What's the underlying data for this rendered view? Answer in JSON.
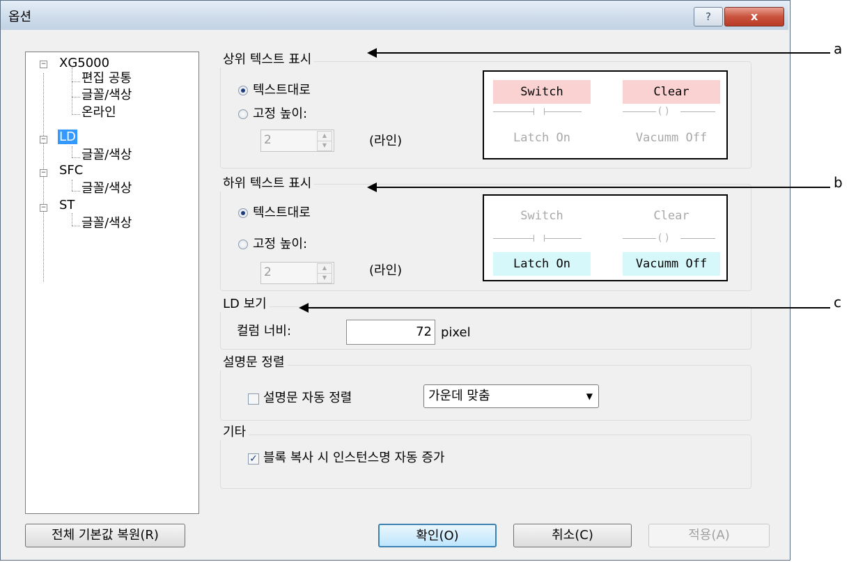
{
  "window": {
    "title": "옵션",
    "help_glyph": "?",
    "close_glyph": "x"
  },
  "tree": {
    "items": [
      {
        "label": "XG5000",
        "expander": "−"
      },
      {
        "label": "편집 공통"
      },
      {
        "label": "글꼴/색상"
      },
      {
        "label": "온라인"
      },
      {
        "label": "LD",
        "expander": "−",
        "selected": true
      },
      {
        "label": "글꼴/색상"
      },
      {
        "label": "SFC",
        "expander": "−"
      },
      {
        "label": "글꼴/색상"
      },
      {
        "label": "ST",
        "expander": "−"
      },
      {
        "label": "글꼴/색상"
      }
    ]
  },
  "upper_text": {
    "group_label": "상위 텍스트 표시",
    "radio_as_text": "텍스트대로",
    "radio_fixed": "고정 높이:",
    "spin_value": "2",
    "unit": "(라인)",
    "preview": {
      "left_top": "Switch",
      "right_top": "Clear",
      "left_bottom": "Latch On",
      "right_bottom": "Vacumm Off",
      "coil": "( )"
    }
  },
  "lower_text": {
    "group_label": "하위 텍스트 표시",
    "radio_as_text": "텍스트대로",
    "radio_fixed": "고정 높이:",
    "spin_value": "2",
    "unit": "(라인)",
    "preview": {
      "left_top": "Switch",
      "right_top": "Clear",
      "left_bottom": "Latch On",
      "right_bottom": "Vacumm Off",
      "coil": "( )"
    }
  },
  "ld_view": {
    "group_label": "LD 보기",
    "column_width_label": "컬럼 너비:",
    "column_width_value": "72",
    "unit": "pixel"
  },
  "comment_align": {
    "group_label": "설명문 정렬",
    "auto_align_label": "설명문 자동 정렬",
    "auto_align_checked": false,
    "align_option": "가운데 맞춤"
  },
  "misc": {
    "group_label": "기타",
    "block_copy_label": "블록 복사 시 인스턴스명 자동 증가",
    "block_copy_checked": true
  },
  "buttons": {
    "restore_defaults": "전체 기본값 복원(R)",
    "ok": "확인(O)",
    "cancel": "취소(C)",
    "apply": "적용(A)"
  },
  "callouts": {
    "a": "a",
    "b": "b",
    "c": "c"
  },
  "colors": {
    "pink_highlight": "#fad2d2",
    "cyan_highlight": "#d7f8fb",
    "selection": "#3399ff"
  }
}
